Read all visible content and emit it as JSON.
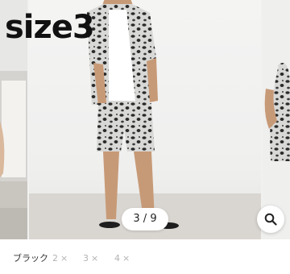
{
  "gallery": {
    "caption": "size3",
    "counter": "3 / 9",
    "zoom_icon": "magnifier-icon"
  },
  "options": {
    "selected": "ブラック",
    "items": [
      {
        "label": "2",
        "mark": "×"
      },
      {
        "label": "3",
        "mark": "×"
      },
      {
        "label": "4",
        "mark": "×"
      }
    ]
  }
}
